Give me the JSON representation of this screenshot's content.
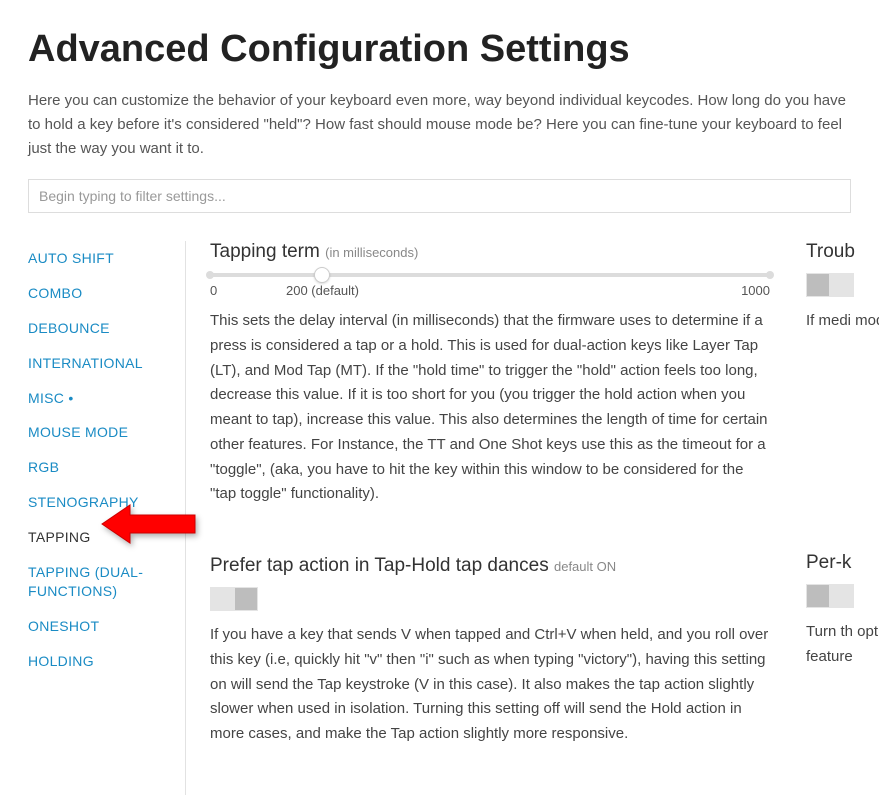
{
  "page": {
    "title": "Advanced Configuration Settings",
    "intro": "Here you can customize the behavior of your keyboard even more, way beyond individual keycodes. How long do you have to hold a key before it's considered \"held\"? How fast should mouse mode be? Here you can fine-tune your keyboard to feel just the way you want it to."
  },
  "filter": {
    "placeholder": "Begin typing to filter settings..."
  },
  "sidebar": {
    "items": [
      {
        "label": "AUTO SHIFT",
        "active": false
      },
      {
        "label": "COMBO",
        "active": false
      },
      {
        "label": "DEBOUNCE",
        "active": false
      },
      {
        "label": "INTERNATIONAL",
        "active": false
      },
      {
        "label": "MISC •",
        "active": false
      },
      {
        "label": "MOUSE MODE",
        "active": false
      },
      {
        "label": "RGB",
        "active": false
      },
      {
        "label": "STENOGRAPHY",
        "active": false
      },
      {
        "label": "TAPPING",
        "active": true
      },
      {
        "label": "TAPPING (DUAL-FUNCTIONS)",
        "active": false
      },
      {
        "label": "ONESHOT",
        "active": false
      },
      {
        "label": "HOLDING",
        "active": false
      }
    ]
  },
  "settings": {
    "tapping_term": {
      "title": "Tapping term",
      "hint": "(in milliseconds)",
      "min": "0",
      "default_label": "200 (default)",
      "max": "1000",
      "desc": "This sets the delay interval (in milliseconds) that the firmware uses to determine if a press is considered a tap or a hold. This is used for dual-action keys like Layer Tap (LT), and Mod Tap (MT). If the \"hold time\" to trigger the \"hold\" action feels too long, decrease this value. If it is too short for you (you trigger the hold action when you meant to tap), increase this value. This also determines the length of time for certain other features. For Instance, the TT and One Shot keys use this as the timeout for a \"toggle\", (aka, you have to hit the key within this window to be considered for the \"tap toggle\" functionality)."
    },
    "troubleshoot": {
      "title": "Troub",
      "desc": "If medi modifie"
    },
    "prefer_tap": {
      "title": "Prefer tap action in Tap-Hold tap dances",
      "hint": "default ON",
      "desc": "If you have a key that sends V when tapped and Ctrl+V when held, and you roll over this key (i.e, quickly hit \"v\" then \"i\" such as when typing \"victory\"), having this setting on will send the Tap keystroke (V in this case). It also makes the tap action slightly slower when used in isolation. Turning this setting off will send the Hold action in more cases, and make the Tap action slightly more responsive."
    },
    "per_key": {
      "title": "Per-k",
      "desc": "Turn th option you're combin feature"
    }
  }
}
